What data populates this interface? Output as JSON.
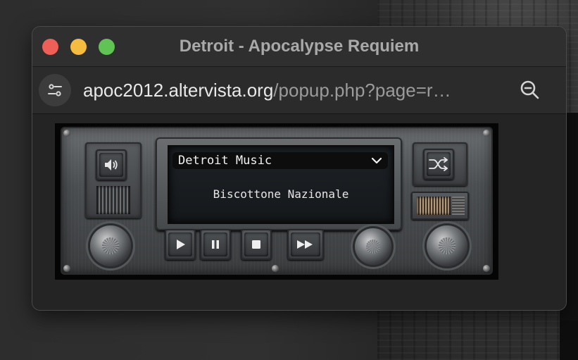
{
  "window": {
    "title": "Detroit - Apocalypse Requiem"
  },
  "addressbar": {
    "url_host": "apoc2012.altervista.org",
    "url_path": "/popup.php?page=r…",
    "site_settings_icon": "sliders-icon",
    "zoom_icon": "zoom-out-icon"
  },
  "player": {
    "station": "Detroit Music",
    "track": "Biscottone Nazionale",
    "icons": {
      "volume": "speaker-icon",
      "shuffle": "shuffle-icon",
      "play": "play-icon",
      "pause": "pause-icon",
      "stop": "stop-icon",
      "forward": "fast-forward-icon",
      "dropdown": "chevron-down-icon"
    }
  },
  "colors": {
    "close": "#ee5f57",
    "minimize": "#f5bd3f",
    "maximize": "#5fc454"
  }
}
